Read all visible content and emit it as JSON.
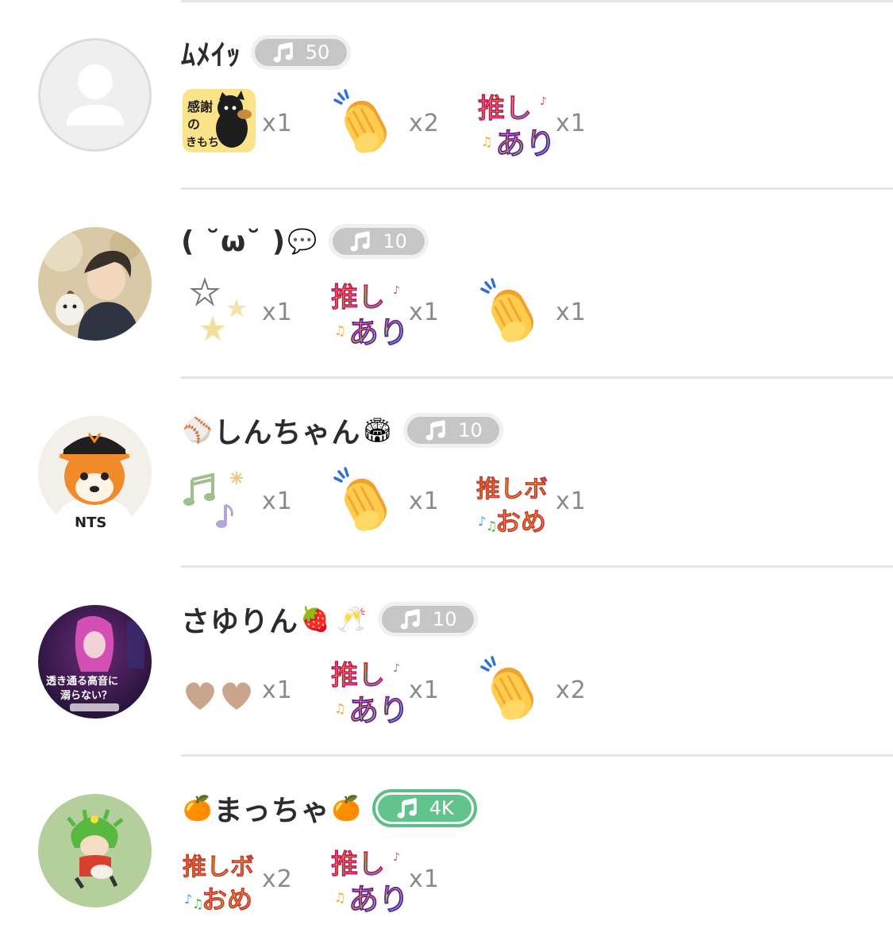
{
  "users": [
    {
      "name": "ﾑﾒｲｯ",
      "name_emoji_before": "",
      "name_emoji_after": "",
      "badge": "50",
      "badge_style": "gray",
      "avatar": "default-avatar",
      "gifts": [
        {
          "sticker": "kansha-cat-sticker",
          "count": "x1"
        },
        {
          "sticker": "clap-sticker",
          "count": "x2"
        },
        {
          "sticker": "oshi-ari-sticker",
          "count": "x1"
        }
      ]
    },
    {
      "name": "( ˘ω˘ )",
      "name_emoji_before": "",
      "name_emoji_after": "💬",
      "badge": "10",
      "badge_style": "gray",
      "avatar": "anime-boy-avatar",
      "gifts": [
        {
          "sticker": "stars-sticker",
          "count": "x1"
        },
        {
          "sticker": "oshi-ari-sticker",
          "count": "x1"
        },
        {
          "sticker": "clap-sticker",
          "count": "x1"
        }
      ]
    },
    {
      "name": "しんちゃん",
      "name_emoji_before": "⚾",
      "name_emoji_after": "🏟",
      "badge": "10",
      "badge_style": "gray",
      "avatar": "mascot-avatar",
      "gifts": [
        {
          "sticker": "music-notes-sticker",
          "count": "x1"
        },
        {
          "sticker": "clap-sticker",
          "count": "x1"
        },
        {
          "sticker": "oshibo-ome-sticker",
          "count": "x1"
        }
      ]
    },
    {
      "name": "さゆりん",
      "name_emoji_before": "",
      "name_emoji_after": "🍓 🥂",
      "badge": "10",
      "badge_style": "gray",
      "avatar": "singer-poster-avatar",
      "avatar_text": "透き通る高音に溺らない？",
      "gifts": [
        {
          "sticker": "hearts-sticker",
          "count": "x1"
        },
        {
          "sticker": "oshi-ari-sticker",
          "count": "x1"
        },
        {
          "sticker": "clap-sticker",
          "count": "x2"
        }
      ]
    },
    {
      "name": "まっちゃ",
      "name_emoji_before": "🍊",
      "name_emoji_after": "🍊",
      "badge": "4K",
      "badge_style": "green",
      "avatar": "green-hair-character-avatar",
      "gifts": [
        {
          "sticker": "oshibo-ome-sticker",
          "count": "x2"
        },
        {
          "sticker": "oshi-ari-sticker",
          "count": "x1"
        }
      ]
    }
  ],
  "colors": {
    "badge_gray": "#c6c6c6",
    "badge_green": "#62c48c",
    "divider": "#e6e6e6",
    "name_text": "#2c2c2c",
    "count_text": "#8a8a8a"
  }
}
